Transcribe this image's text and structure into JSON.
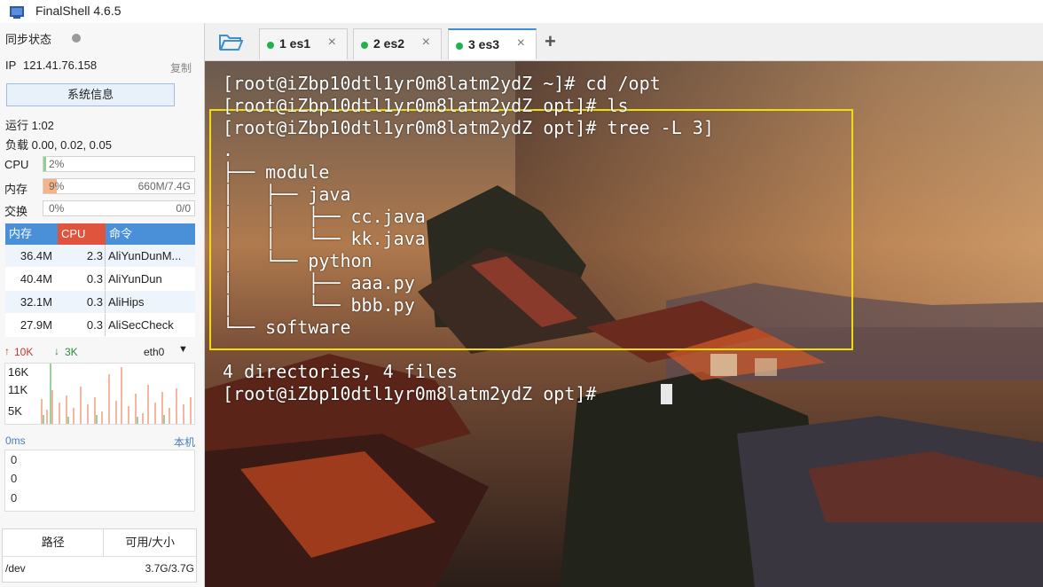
{
  "window": {
    "title": "FinalShell 4.6.5"
  },
  "sidebar": {
    "sync_label": "同步状态",
    "ip_label": "IP",
    "ip_value": "121.41.76.158",
    "copy_label": "复制",
    "sysinfo_button": "系统信息",
    "uptime": "运行 1:02",
    "load": "负载 0.00, 0.02, 0.05",
    "metrics": [
      {
        "label": "CPU",
        "value": "2%",
        "fraction": 0.02,
        "extra": "",
        "color": "#8fcf8f"
      },
      {
        "label": "内存",
        "value": "9%",
        "fraction": 0.09,
        "extra": "660M/7.4G",
        "color": "#f5b38a"
      },
      {
        "label": "交换",
        "value": "0%",
        "fraction": 0.0,
        "extra": "0/0",
        "color": "#8fcf8f"
      }
    ],
    "process_table": {
      "headers": [
        "内存",
        "CPU",
        "命令"
      ],
      "rows": [
        [
          "36.4M",
          "2.3",
          "AliYunDunM..."
        ],
        [
          "40.4M",
          "0.3",
          "AliYunDun"
        ],
        [
          "32.1M",
          "0.3",
          "AliHips"
        ],
        [
          "27.9M",
          "0.3",
          "AliSecCheck"
        ]
      ]
    },
    "network": {
      "upload": "10K",
      "download": "3K",
      "interface": "eth0",
      "y_ticks": [
        "16K",
        "11K",
        "5K"
      ]
    },
    "latency": {
      "label": "0ms",
      "host": "本机",
      "values": [
        "0",
        "0",
        "0"
      ]
    },
    "disk_table": {
      "headers": [
        "路径",
        "可用/大小"
      ],
      "rows": [
        [
          "/dev",
          "3.7G/3.7G"
        ]
      ]
    }
  },
  "tabs": [
    {
      "label": "1 es1",
      "active": false
    },
    {
      "label": "2 es2",
      "active": false
    },
    {
      "label": "3 es3",
      "active": true
    }
  ],
  "terminal": {
    "text": "[root@iZbp10dtl1yr0m8latm2ydZ ~]# cd /opt\n[root@iZbp10dtl1yr0m8latm2ydZ opt]# ls\n[root@iZbp10dtl1yr0m8latm2ydZ opt]# tree -L 3]\n.\n├── module\n│   ├── java\n│   │   ├── cc.java\n│   │   └── kk.java\n│   └── python\n│       ├── aaa.py\n│       └── bbb.py\n└── software\n\n4 directories, 4 files\n[root@iZbp10dtl1yr0m8latm2ydZ opt]# "
  },
  "colors": {
    "accent": "#3b8ed8",
    "connected": "#22b24c",
    "highlight": "#f3dc0e",
    "cpu_header": "#e0533c",
    "header_blue": "#4a90d9"
  }
}
